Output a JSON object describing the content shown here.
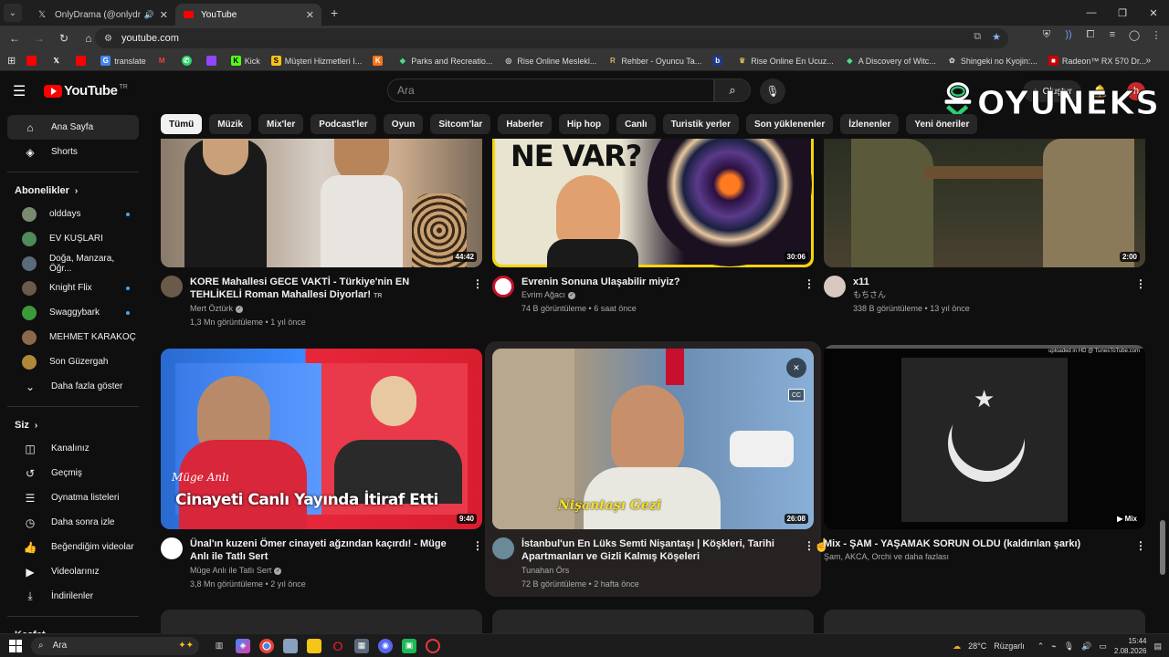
{
  "browser": {
    "tabs": [
      {
        "title": "OnlyDrama (@onlydramaX",
        "active": false
      },
      {
        "title": "YouTube",
        "active": true
      }
    ],
    "url": "youtube.com",
    "bookmarks": [
      "translate",
      "Kick",
      "Müşteri Hizmetleri I...",
      "Parks and Recreatio...",
      "Rise Online Meslekl...",
      "Rehber - Oyuncu Ta...",
      "Rise Online En Ucuz...",
      "A Discovery of Witc...",
      "Shingeki no Kyojin:...",
      "Radeon™ RX 570 Dr..."
    ]
  },
  "youtube": {
    "logo": "YouTube",
    "logo_region": "TR",
    "search_placeholder": "Ara",
    "create_label": "Oluştur",
    "avatar_letter": "h"
  },
  "watermark": {
    "text": "OYUNEKS"
  },
  "chips": [
    "Tümü",
    "Müzik",
    "Mix'ler",
    "Podcast'ler",
    "Oyun",
    "Sitcom'lar",
    "Haberler",
    "Hip hop",
    "Canlı",
    "Turistik yerler",
    "Son yüklenenler",
    "İzlenenler",
    "Yeni öneriler"
  ],
  "sidebar": {
    "top": [
      {
        "label": "Ana Sayfa",
        "icon": "home-icon"
      },
      {
        "label": "Shorts",
        "icon": "shorts-icon"
      }
    ],
    "subs_header": "Abonelikler",
    "subscriptions": [
      {
        "label": "olddays",
        "dot": true,
        "color": "#7a8a70"
      },
      {
        "label": "EV KUŞLARI",
        "dot": false,
        "color": "#4e8a5a"
      },
      {
        "label": "Doğa, Manzara, Öğr...",
        "dot": false,
        "color": "#5a6a7a"
      },
      {
        "label": "Knight Flix",
        "dot": true,
        "color": "#6a5a4a"
      },
      {
        "label": "Swaggybark",
        "dot": true,
        "color": "#3c9a3c"
      },
      {
        "label": "MEHMET KARAKOÇ",
        "dot": false,
        "color": "#8a6a4a"
      },
      {
        "label": "Son Güzergah",
        "dot": false,
        "color": "#b0883a"
      }
    ],
    "show_more": "Daha fazla göster",
    "you_header": "Siz",
    "you": [
      {
        "label": "Kanalınız",
        "icon": "channel-icon"
      },
      {
        "label": "Geçmiş",
        "icon": "history-icon"
      },
      {
        "label": "Oynatma listeleri",
        "icon": "playlist-icon"
      },
      {
        "label": "Daha sonra izle",
        "icon": "watch-later-icon"
      },
      {
        "label": "Beğendiğim videolar",
        "icon": "like-icon"
      },
      {
        "label": "Videolarınız",
        "icon": "videos-icon"
      },
      {
        "label": "İndirilenler",
        "icon": "download-icon"
      }
    ],
    "explore_header": "Keşfet"
  },
  "videos": [
    {
      "title": "KORE Mahallesi GECE VAKTİ - Türkiye'nin EN TEHLİKELİ Roman Mahallesi Diyorlar!",
      "badge": "TR",
      "channel": "Mert Öztürk",
      "verified": true,
      "meta": "1,3 Mn görüntüleme • 1 yıl önce",
      "duration": "44:42"
    },
    {
      "title": "Evrenin Sonuna Ulaşabilir miyiz?",
      "badge": "",
      "channel": "Evrim Ağacı",
      "verified": true,
      "meta": "74 B görüntüleme • 6 saat önce",
      "duration": "30:06",
      "thumb_text": "NE VAR?"
    },
    {
      "title": "x11",
      "badge": "",
      "channel": "もちさん",
      "verified": false,
      "meta": "338 B görüntüleme • 13 yıl önce",
      "duration": "2:00"
    },
    {
      "title": "Ünal'ın kuzeni Ömer cinayeti ağzından kaçırdı! - Müge Anlı ile Tatlı Sert",
      "badge": "",
      "channel": "Müge Anlı ile Tatlı Sert",
      "verified": true,
      "meta": "3,8 Mn görüntüleme • 2 yıl önce",
      "duration": "9:40",
      "thumb_text": "Cinayeti Canlı Yayında İtiraf Etti",
      "thumb_sub": "Müge Anlı"
    },
    {
      "title": "İstanbul'un En Lüks Semti Nişantaşı | Köşkleri, Tarihi Apartmanları ve Gizli Kalmış Köşeleri",
      "badge": "",
      "channel": "Tunahan Örs",
      "verified": false,
      "meta": "72 B görüntüleme • 2 hafta önce",
      "duration": "26:08",
      "thumb_text": "Nişantaşı Gezi"
    },
    {
      "title": "Mix - ŞAM - YAŞAMAK SORUN OLDU (kaldırılan şarkı)",
      "badge": "",
      "channel": "Şam, AKCA, Orchi ve daha fazlası",
      "verified": false,
      "meta": "",
      "duration": "Mix",
      "thumb_text": "uploaded in HD @ TunesToTube.com"
    }
  ],
  "taskbar": {
    "search": "Ara",
    "weather": "28°C",
    "weather_label": "Rüzgarlı",
    "time": "15:44",
    "date": "2.08.2026"
  }
}
